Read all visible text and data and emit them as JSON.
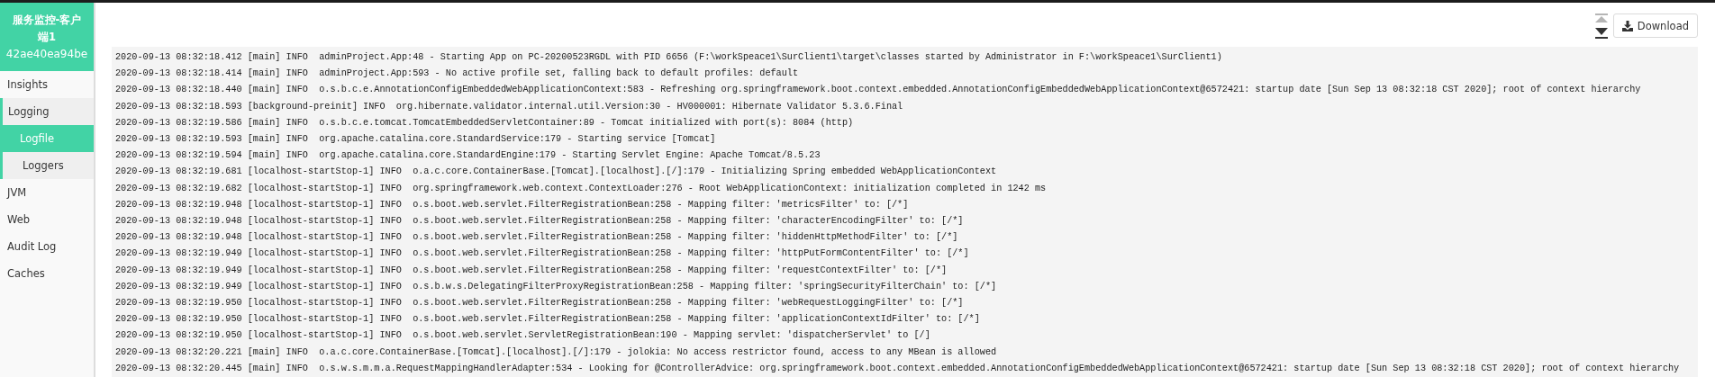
{
  "sidebar": {
    "title": "服务监控-客户端1",
    "subtitle": "42ae40ea94be",
    "items": [
      {
        "label": "Insights",
        "selected": false,
        "expanded": false
      },
      {
        "label": "Logging",
        "selected": false,
        "expanded": true,
        "children": [
          {
            "label": "Logfile",
            "selected": true
          },
          {
            "label": "Loggers",
            "selected": false
          }
        ]
      },
      {
        "label": "JVM",
        "selected": false,
        "expanded": false
      },
      {
        "label": "Web",
        "selected": false,
        "expanded": false
      },
      {
        "label": "Audit Log",
        "selected": false,
        "expanded": false
      },
      {
        "label": "Caches",
        "selected": false,
        "expanded": false
      }
    ]
  },
  "toolbar": {
    "download_label": "Download"
  },
  "log_lines": [
    "2020-09-13 08:32:18.412 [main] INFO  adminProject.App:48 - Starting App on PC-20200523RGDL with PID 6656 (F:\\workSpeace1\\SurClient1\\target\\classes started by Administrator in F:\\workSpeace1\\SurClient1)",
    "2020-09-13 08:32:18.414 [main] INFO  adminProject.App:593 - No active profile set, falling back to default profiles: default",
    "2020-09-13 08:32:18.440 [main] INFO  o.s.b.c.e.AnnotationConfigEmbeddedWebApplicationContext:583 - Refreshing org.springframework.boot.context.embedded.AnnotationConfigEmbeddedWebApplicationContext@6572421: startup date [Sun Sep 13 08:32:18 CST 2020]; root of context hierarchy",
    "2020-09-13 08:32:18.593 [background-preinit] INFO  org.hibernate.validator.internal.util.Version:30 - HV000001: Hibernate Validator 5.3.6.Final",
    "2020-09-13 08:32:19.586 [main] INFO  o.s.b.c.e.tomcat.TomcatEmbeddedServletContainer:89 - Tomcat initialized with port(s): 8084 (http)",
    "2020-09-13 08:32:19.593 [main] INFO  org.apache.catalina.core.StandardService:179 - Starting service [Tomcat]",
    "2020-09-13 08:32:19.594 [main] INFO  org.apache.catalina.core.StandardEngine:179 - Starting Servlet Engine: Apache Tomcat/8.5.23",
    "2020-09-13 08:32:19.681 [localhost-startStop-1] INFO  o.a.c.core.ContainerBase.[Tomcat].[localhost].[/]:179 - Initializing Spring embedded WebApplicationContext",
    "2020-09-13 08:32:19.682 [localhost-startStop-1] INFO  org.springframework.web.context.ContextLoader:276 - Root WebApplicationContext: initialization completed in 1242 ms",
    "2020-09-13 08:32:19.948 [localhost-startStop-1] INFO  o.s.boot.web.servlet.FilterRegistrationBean:258 - Mapping filter: 'metricsFilter' to: [/*]",
    "2020-09-13 08:32:19.948 [localhost-startStop-1] INFO  o.s.boot.web.servlet.FilterRegistrationBean:258 - Mapping filter: 'characterEncodingFilter' to: [/*]",
    "2020-09-13 08:32:19.948 [localhost-startStop-1] INFO  o.s.boot.web.servlet.FilterRegistrationBean:258 - Mapping filter: 'hiddenHttpMethodFilter' to: [/*]",
    "2020-09-13 08:32:19.949 [localhost-startStop-1] INFO  o.s.boot.web.servlet.FilterRegistrationBean:258 - Mapping filter: 'httpPutFormContentFilter' to: [/*]",
    "2020-09-13 08:32:19.949 [localhost-startStop-1] INFO  o.s.boot.web.servlet.FilterRegistrationBean:258 - Mapping filter: 'requestContextFilter' to: [/*]",
    "2020-09-13 08:32:19.949 [localhost-startStop-1] INFO  o.s.b.w.s.DelegatingFilterProxyRegistrationBean:258 - Mapping filter: 'springSecurityFilterChain' to: [/*]",
    "2020-09-13 08:32:19.950 [localhost-startStop-1] INFO  o.s.boot.web.servlet.FilterRegistrationBean:258 - Mapping filter: 'webRequestLoggingFilter' to: [/*]",
    "2020-09-13 08:32:19.950 [localhost-startStop-1] INFO  o.s.boot.web.servlet.FilterRegistrationBean:258 - Mapping filter: 'applicationContextIdFilter' to: [/*]",
    "2020-09-13 08:32:19.950 [localhost-startStop-1] INFO  o.s.boot.web.servlet.ServletRegistrationBean:190 - Mapping servlet: 'dispatcherServlet' to [/]",
    "2020-09-13 08:32:20.221 [main] INFO  o.a.c.core.ContainerBase.[Tomcat].[localhost].[/]:179 - jolokia: No access restrictor found, access to any MBean is allowed",
    "2020-09-13 08:32:20.445 [main] INFO  o.s.w.s.m.m.a.RequestMappingHandlerAdapter:534 - Looking for @ControllerAdvice: org.springframework.boot.context.embedded.AnnotationConfigEmbeddedWebApplicationContext@6572421: startup date [Sun Sep 13 08:32:18 CST 2020]; root of context hierarchy"
  ]
}
